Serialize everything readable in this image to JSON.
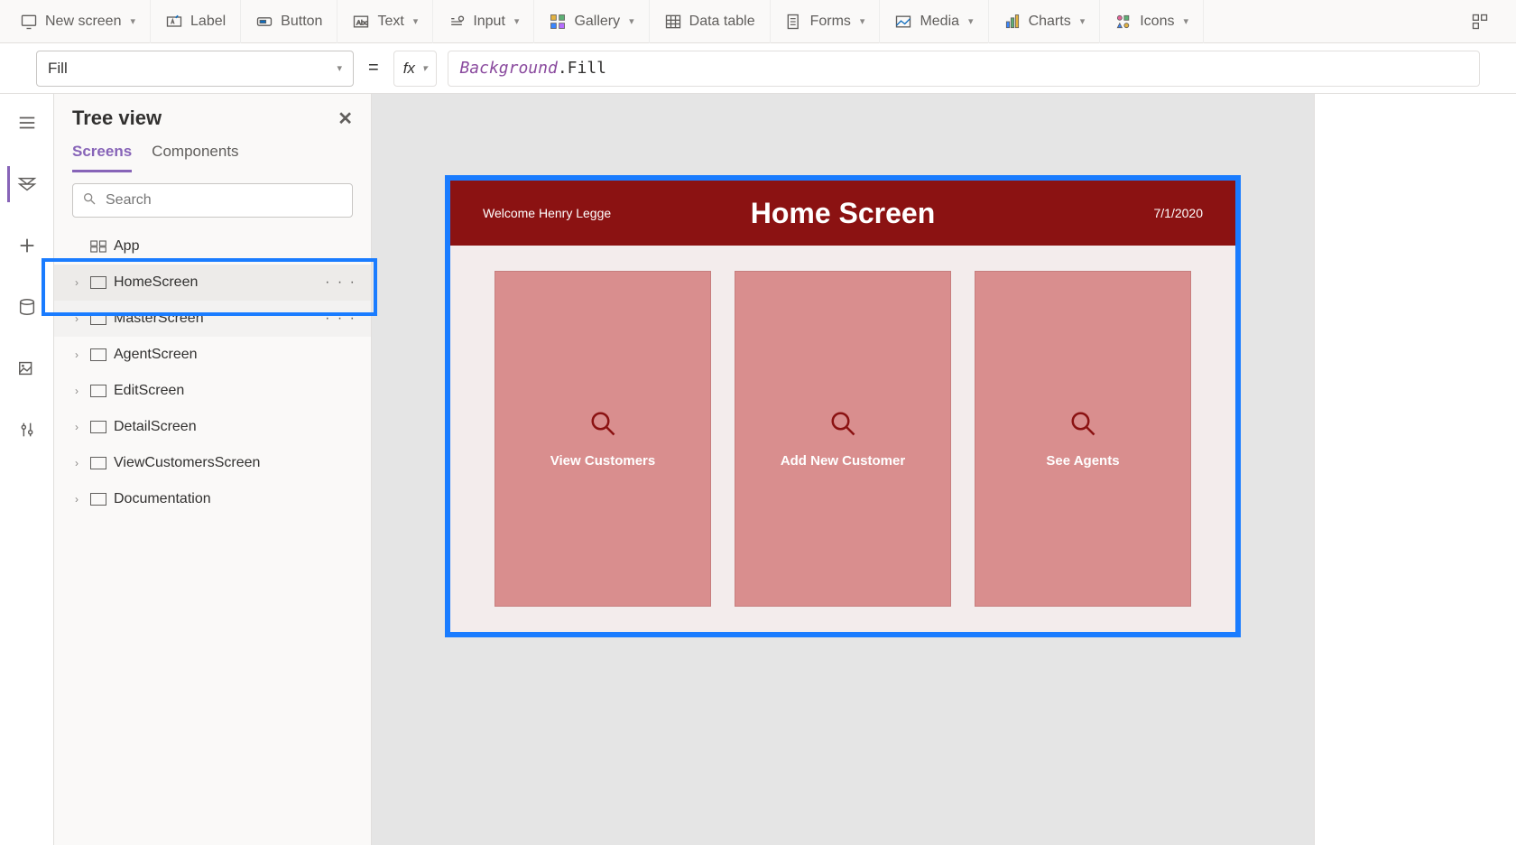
{
  "ribbon": {
    "new_screen": "New screen",
    "label": "Label",
    "button": "Button",
    "text": "Text",
    "input": "Input",
    "gallery": "Gallery",
    "data_table": "Data table",
    "forms": "Forms",
    "media": "Media",
    "charts": "Charts",
    "icons": "Icons"
  },
  "formula": {
    "property": "Fill",
    "fx": "fx",
    "identifier": "Background",
    "member": ".Fill"
  },
  "tree": {
    "title": "Tree view",
    "tabs": {
      "screens": "Screens",
      "components": "Components"
    },
    "search_placeholder": "Search",
    "items": [
      {
        "label": "App",
        "selected": false,
        "hover": false,
        "icon": "app"
      },
      {
        "label": "HomeScreen",
        "selected": true,
        "hover": false,
        "icon": "screen"
      },
      {
        "label": "MasterScreen",
        "selected": false,
        "hover": true,
        "icon": "screen"
      },
      {
        "label": "AgentScreen",
        "selected": false,
        "hover": false,
        "icon": "screen"
      },
      {
        "label": "EditScreen",
        "selected": false,
        "hover": false,
        "icon": "screen"
      },
      {
        "label": "DetailScreen",
        "selected": false,
        "hover": false,
        "icon": "screen"
      },
      {
        "label": "ViewCustomersScreen",
        "selected": false,
        "hover": false,
        "icon": "screen"
      },
      {
        "label": "Documentation",
        "selected": false,
        "hover": false,
        "icon": "screen"
      }
    ]
  },
  "canvas": {
    "welcome": "Welcome Henry Legge",
    "title": "Home Screen",
    "date": "7/1/2020",
    "cards": [
      {
        "label": "View Customers"
      },
      {
        "label": "Add New Customer"
      },
      {
        "label": "See Agents"
      }
    ]
  }
}
